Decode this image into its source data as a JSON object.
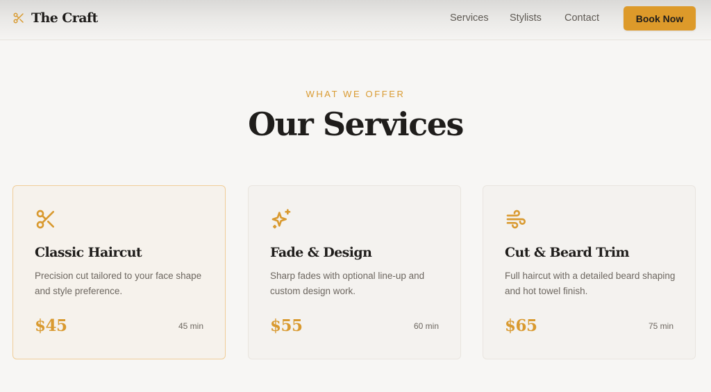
{
  "brand": {
    "name": "The Craft",
    "icon": "scissors-icon"
  },
  "nav": {
    "links": [
      "Services",
      "Stylists",
      "Contact"
    ],
    "cta_label": "Book Now"
  },
  "section": {
    "eyebrow": "WHAT WE OFFER",
    "title": "Our Services"
  },
  "services": [
    {
      "icon": "scissors-icon",
      "title": "Classic Haircut",
      "description": "Precision cut tailored to your face shape and style preference.",
      "price": "$45",
      "duration": "45 min"
    },
    {
      "icon": "sparkles-icon",
      "title": "Fade & Design",
      "description": "Sharp fades with optional line-up and custom design work.",
      "price": "$55",
      "duration": "60 min"
    },
    {
      "icon": "wind-icon",
      "title": "Cut & Beard Trim",
      "description": "Full haircut with a detailed beard shaping and hot towel finish.",
      "price": "$65",
      "duration": "75 min"
    }
  ],
  "colors": {
    "accent": "#dd9a2a",
    "text": "#1f1d1b",
    "muted": "#6c665f",
    "background": "#f7f6f4"
  }
}
